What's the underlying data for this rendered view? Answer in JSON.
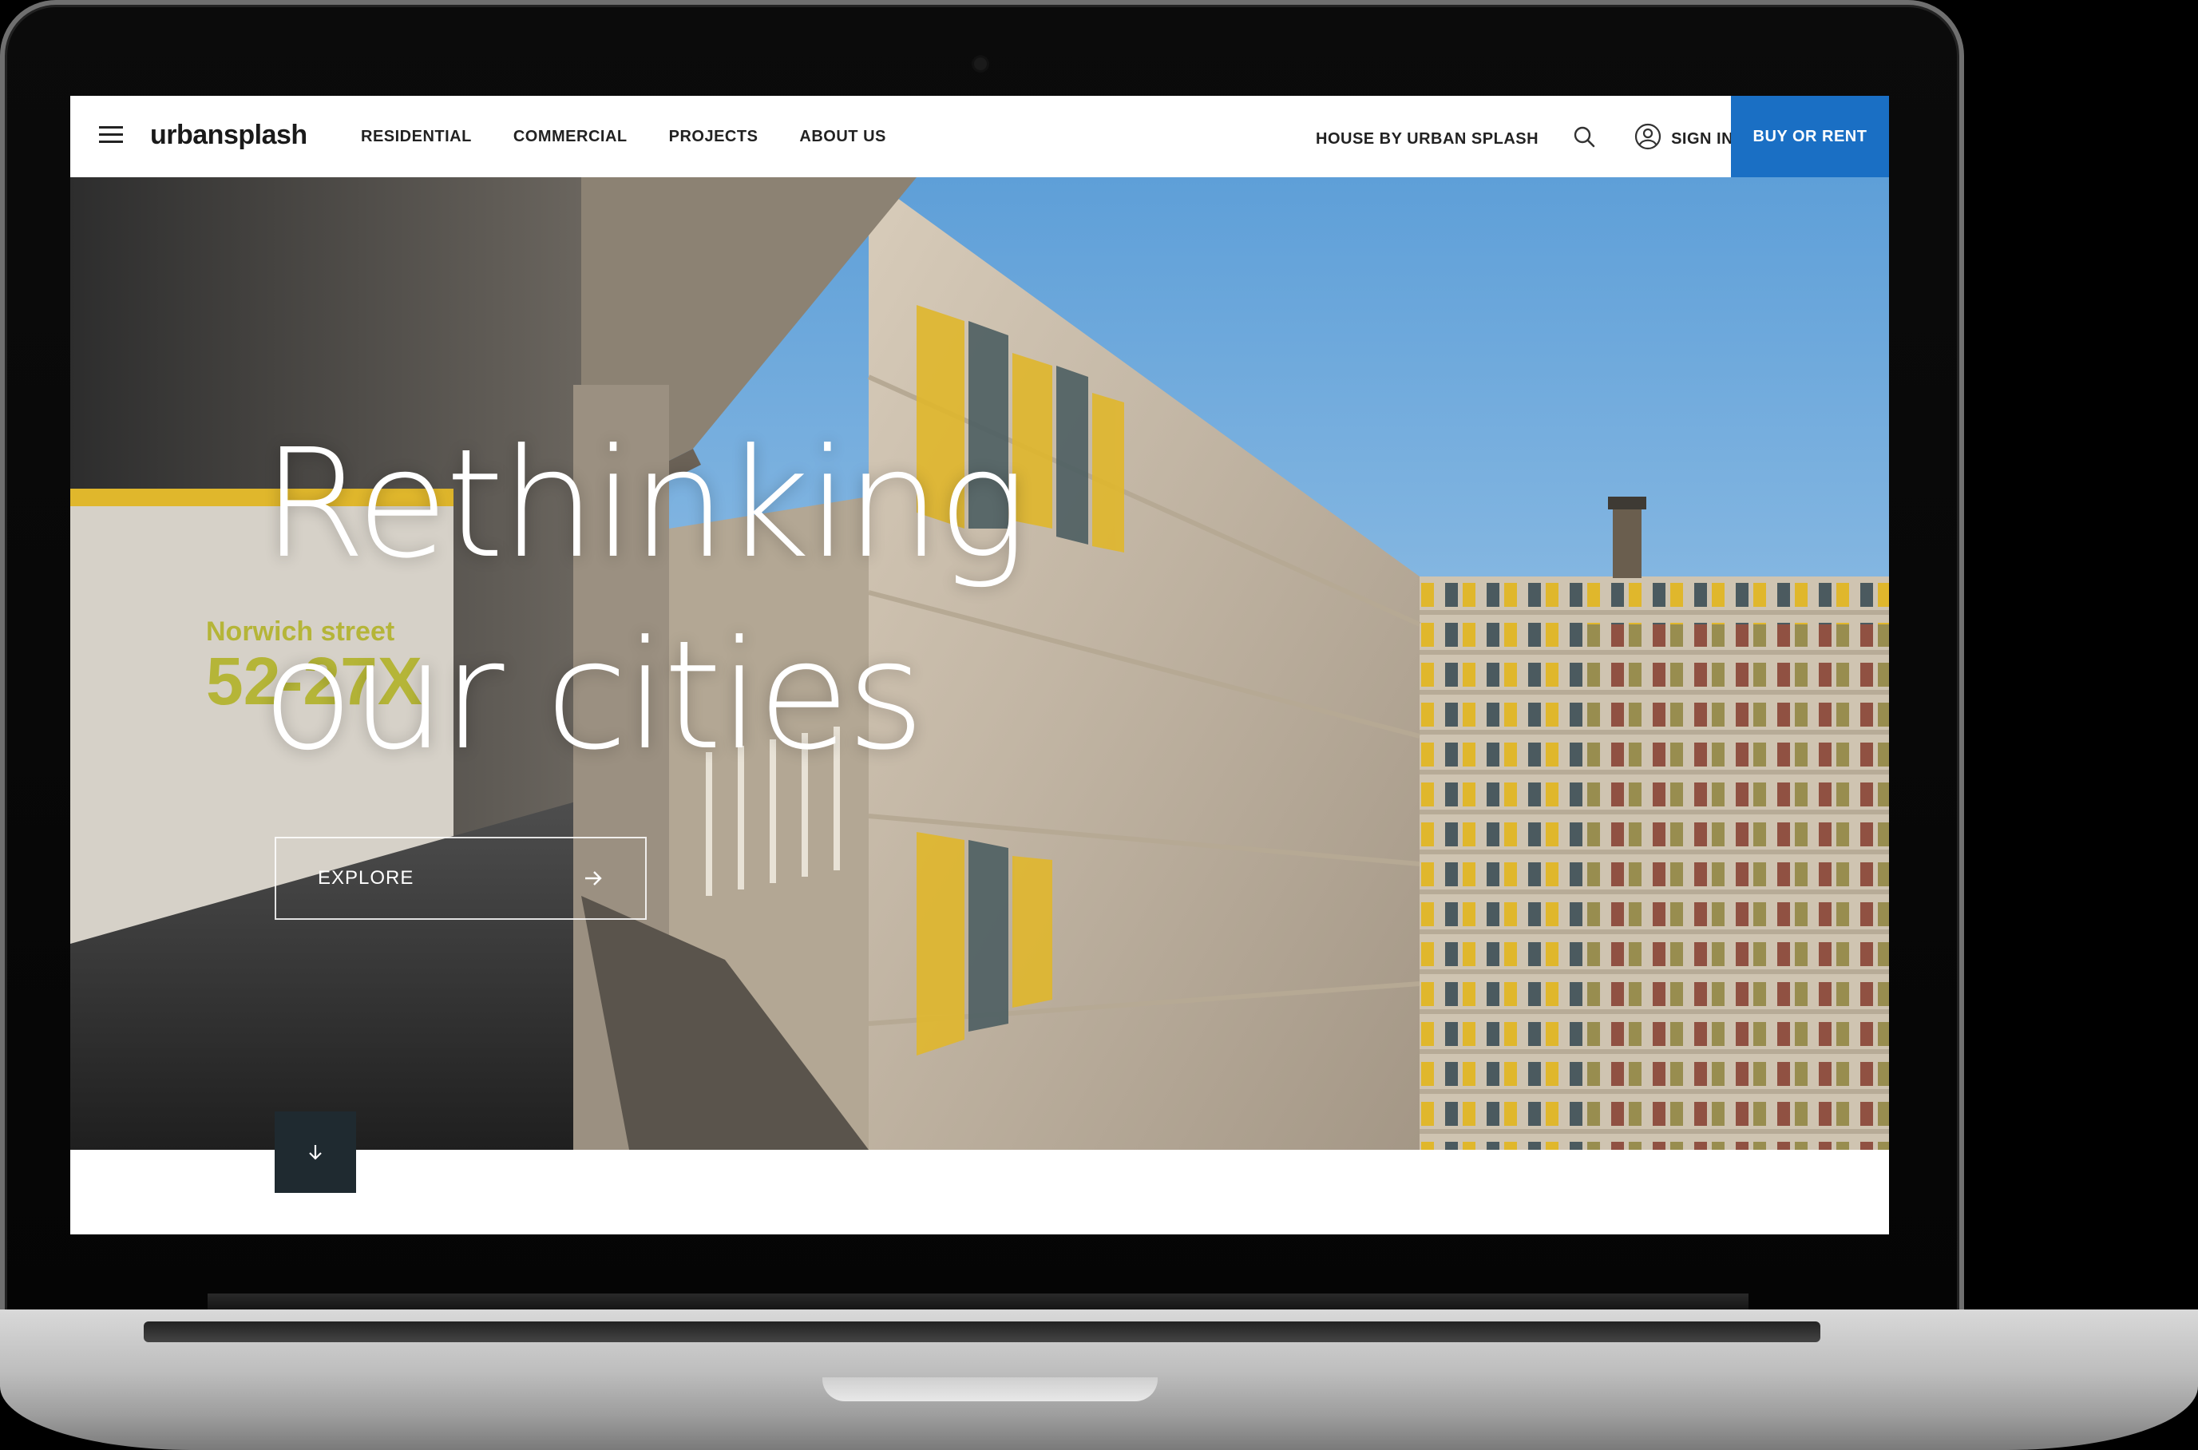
{
  "header": {
    "logo": "urbansplash",
    "nav": [
      "RESIDENTIAL",
      "COMMERCIAL",
      "PROJECTS",
      "ABOUT US"
    ],
    "house_link": "HOUSE BY URBAN SPLASH",
    "sign_in": "SIGN IN",
    "cta": "BUY OR RENT",
    "cta_color": "#1a6fc4"
  },
  "hero": {
    "headline_line1": "Rethinking",
    "headline_line2": "our cities",
    "explore_label": "EXPLORE",
    "sign_text_line1": "Norwich street",
    "sign_text_line2": "52-27X"
  },
  "icons": {
    "menu": "hamburger-menu-icon",
    "search": "search-icon",
    "user": "user-icon",
    "explore_arrow": "arrow-right-icon",
    "scroll": "arrow-down-icon"
  }
}
